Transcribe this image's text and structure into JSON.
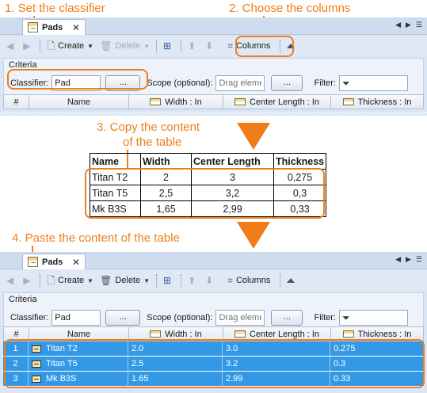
{
  "annotations": {
    "step1": "1. Set the classifier",
    "step2": "2. Choose the columns",
    "step3_line1": "3. Copy the content",
    "step3_line2": "of the table",
    "step4": "4. Paste the content of the table"
  },
  "panel": {
    "tab_label": "Pads",
    "tab_close": "✕",
    "toolbar": {
      "create_label": "Create",
      "delete_label": "Delete",
      "columns_label": "Columns"
    },
    "criteria": {
      "title": "Criteria",
      "classifier_label": "Classifier:",
      "classifier_value": "Pad",
      "browse_label": "...",
      "scope_label": "Scope (optional):",
      "scope_placeholder": "Drag elemer",
      "filter_label": "Filter:"
    },
    "columns": [
      "#",
      "Name",
      "Width : In",
      "Center Length : In",
      "Thickness : In"
    ]
  },
  "copy_table": {
    "headers": [
      "Name",
      "Width",
      "Center Length",
      "Thickness"
    ],
    "rows": [
      [
        "Titan T2",
        "2",
        "3",
        "0,275"
      ],
      [
        "Titan T5",
        "2,5",
        "3,2",
        "0,3"
      ],
      [
        "Mk B3S",
        "1,65",
        "2,99",
        "0,33"
      ]
    ]
  },
  "pasted_rows": [
    {
      "num": "1",
      "name": "Titan T2",
      "width": "2.0",
      "center": "3.0",
      "thickness": "0.275"
    },
    {
      "num": "2",
      "name": "Titan T5",
      "width": "2.5",
      "center": "3.2",
      "thickness": "0.3"
    },
    {
      "num": "3",
      "name": "Mk B3S",
      "width": "1.65",
      "center": "2.99",
      "thickness": "0.33"
    }
  ],
  "colors": {
    "annotation": "#f07d1a",
    "selection": "#3399e6",
    "panel": "#dbe6f5"
  }
}
